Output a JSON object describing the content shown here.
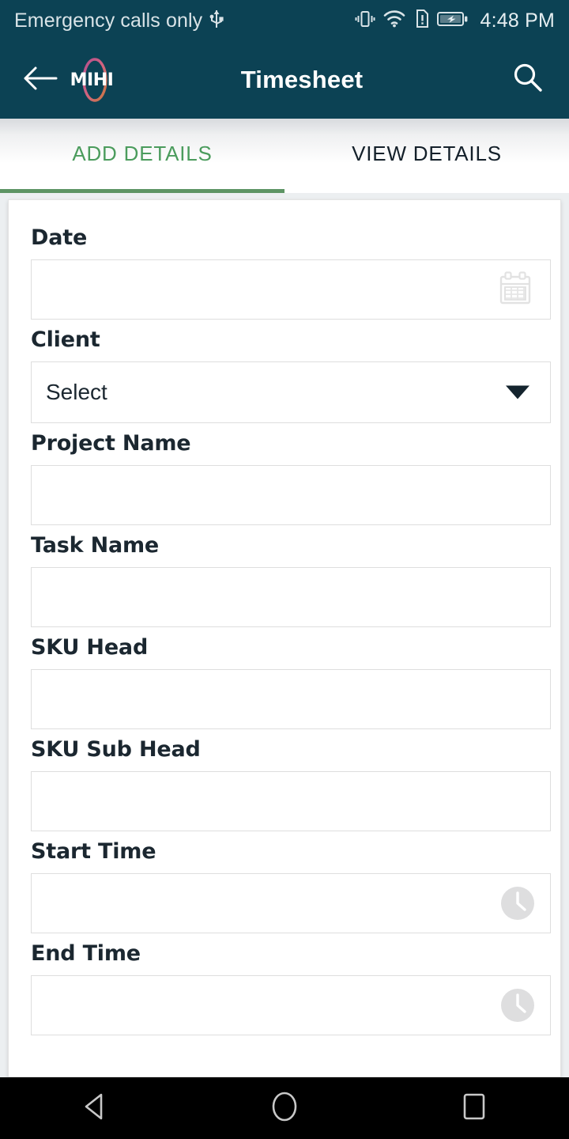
{
  "status_bar": {
    "carrier_text": "Emergency calls only",
    "usb_icon": "usb-icon",
    "vibrate_icon": "vibrate-icon",
    "wifi_icon": "wifi-icon",
    "sim_alert_icon": "sim-card-alert-icon",
    "battery_icon": "battery-charging-icon",
    "time": "4:48 PM"
  },
  "app_bar": {
    "back_icon": "back-arrow-icon",
    "logo_text": "MIHI",
    "title": "Timesheet",
    "search_icon": "search-icon",
    "background_color": "#0c4254"
  },
  "tabs": {
    "active_index": 0,
    "accent_color": "#4b9c5d",
    "underline_color": "#5d9464",
    "items": [
      {
        "label": "ADD DETAILS",
        "active": true
      },
      {
        "label": "VIEW DETAILS",
        "active": false
      }
    ]
  },
  "form": {
    "fields": [
      {
        "label": "Date",
        "value": "",
        "placeholder": "",
        "kind": "date",
        "icon": "calendar-icon"
      },
      {
        "label": "Client",
        "value": "Select",
        "placeholder": "",
        "kind": "select",
        "icon": "chevron-down-icon"
      },
      {
        "label": "Project Name",
        "value": "",
        "placeholder": "",
        "kind": "text",
        "icon": ""
      },
      {
        "label": "Task Name",
        "value": "",
        "placeholder": "",
        "kind": "text",
        "icon": ""
      },
      {
        "label": "SKU Head",
        "value": "",
        "placeholder": "",
        "kind": "text",
        "icon": ""
      },
      {
        "label": "SKU Sub Head",
        "value": "",
        "placeholder": "",
        "kind": "text",
        "icon": ""
      },
      {
        "label": "Start Time",
        "value": "",
        "placeholder": "",
        "kind": "time",
        "icon": "clock-icon"
      },
      {
        "label": "End Time",
        "value": "",
        "placeholder": "",
        "kind": "time",
        "icon": "clock-icon"
      }
    ]
  },
  "nav_bar": {
    "back_icon": "nav-back-triangle-icon",
    "home_icon": "nav-home-circle-icon",
    "recents_icon": "nav-recents-square-icon"
  }
}
